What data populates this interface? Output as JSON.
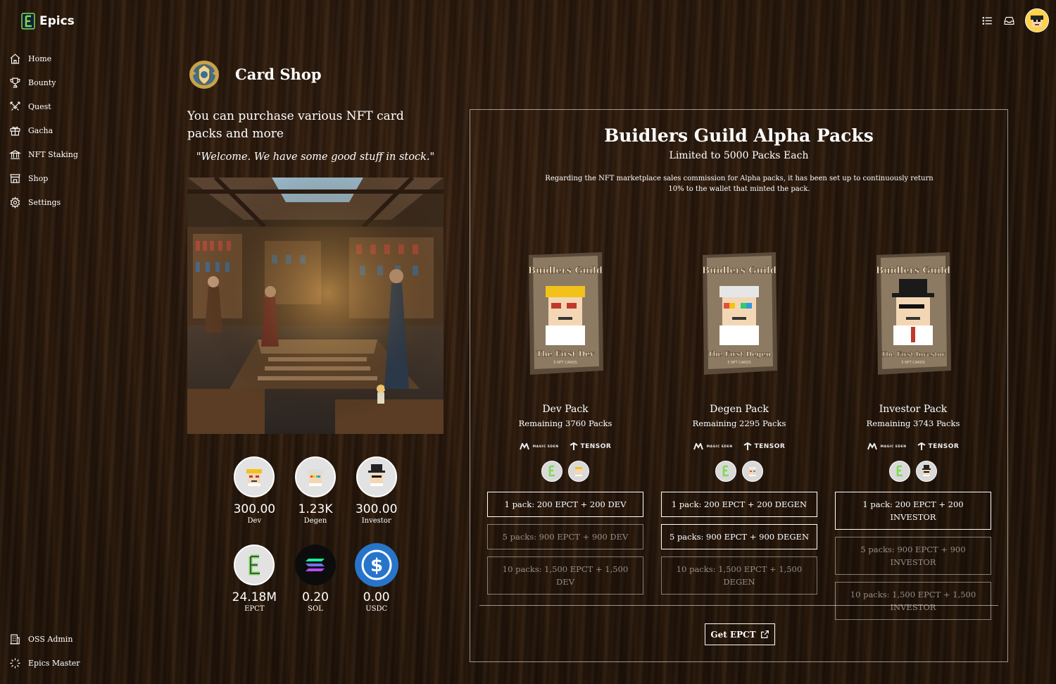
{
  "app": {
    "name": "Epics"
  },
  "sidebar": {
    "items": [
      {
        "label": "Home",
        "icon": "home-icon"
      },
      {
        "label": "Bounty",
        "icon": "trophy-icon"
      },
      {
        "label": "Quest",
        "icon": "crossed-swords-icon"
      },
      {
        "label": "Gacha",
        "icon": "gift-icon"
      },
      {
        "label": "NFT Staking",
        "icon": "bank-icon"
      },
      {
        "label": "Shop",
        "icon": "store-icon"
      },
      {
        "label": "Settings",
        "icon": "gear-icon"
      }
    ],
    "bottom": [
      {
        "label": "OSS Admin",
        "icon": "building-icon"
      },
      {
        "label": "Epics Master",
        "icon": "sparkle-icon"
      }
    ]
  },
  "page": {
    "title": "Card Shop",
    "intro": "You can purchase various NFT card packs and more",
    "quote": "\"Welcome. We have some good stuff in stock.\""
  },
  "balances": [
    {
      "value": "300.00",
      "label": "Dev"
    },
    {
      "value": "1.23K",
      "label": "Degen"
    },
    {
      "value": "300.00",
      "label": "Investor"
    },
    {
      "value": "24.18M",
      "label": "EPCT"
    },
    {
      "value": "0.20",
      "label": "SOL"
    },
    {
      "value": "0.00",
      "label": "USDC"
    }
  ],
  "panel": {
    "title": "Buidlers Guild Alpha Packs",
    "subtitle": "Limited to 5000 Packs Each",
    "description": "Regarding the NFT marketplace sales commission for Alpha packs, it has been set up to continuously return 10% to the wallet that minted the pack.",
    "packs": [
      {
        "art_title": "Buidlers Guild",
        "art_name": "The First Dev",
        "art_count": "5 NFT CARDS",
        "name": "Dev Pack",
        "remaining": "Remaining 3760 Packs",
        "buttons": [
          "1 pack: 200 EPCT + 200 DEV",
          "5 packs: 900 EPCT + 900 DEV",
          "10 packs: 1,500 EPCT + 1,500 DEV"
        ]
      },
      {
        "art_title": "Buidlers Guild",
        "art_name": "The First Degen",
        "art_count": "5 NFT CARDS",
        "name": "Degen Pack",
        "remaining": "Remaining 2295 Packs",
        "buttons": [
          "1 pack: 200 EPCT + 200 DEGEN",
          "5 packs: 900 EPCT + 900 DEGEN",
          "10 packs: 1,500 EPCT + 1,500 DEGEN"
        ]
      },
      {
        "art_title": "Buidlers Guild",
        "art_name": "The First Investor",
        "art_count": "5 NFT CARDS",
        "name": "Investor Pack",
        "remaining": "Remaining 3743 Packs",
        "buttons": [
          "1 pack: 200 EPCT + 200 INVESTOR",
          "5 packs: 900 EPCT + 900 INVESTOR",
          "10 packs: 1,500 EPCT + 1,500 INVESTOR"
        ]
      }
    ],
    "markets": {
      "magic_eden": "MAGIC EDEN",
      "tensor": "TENSOR"
    },
    "get_button": "Get EPCT"
  },
  "colors": {
    "accent": "#ffffff",
    "epct_green": "#7ed957",
    "sol_purple": "#9945ff",
    "usdc_blue": "#2775ca",
    "wood": "#2a1a0e"
  }
}
